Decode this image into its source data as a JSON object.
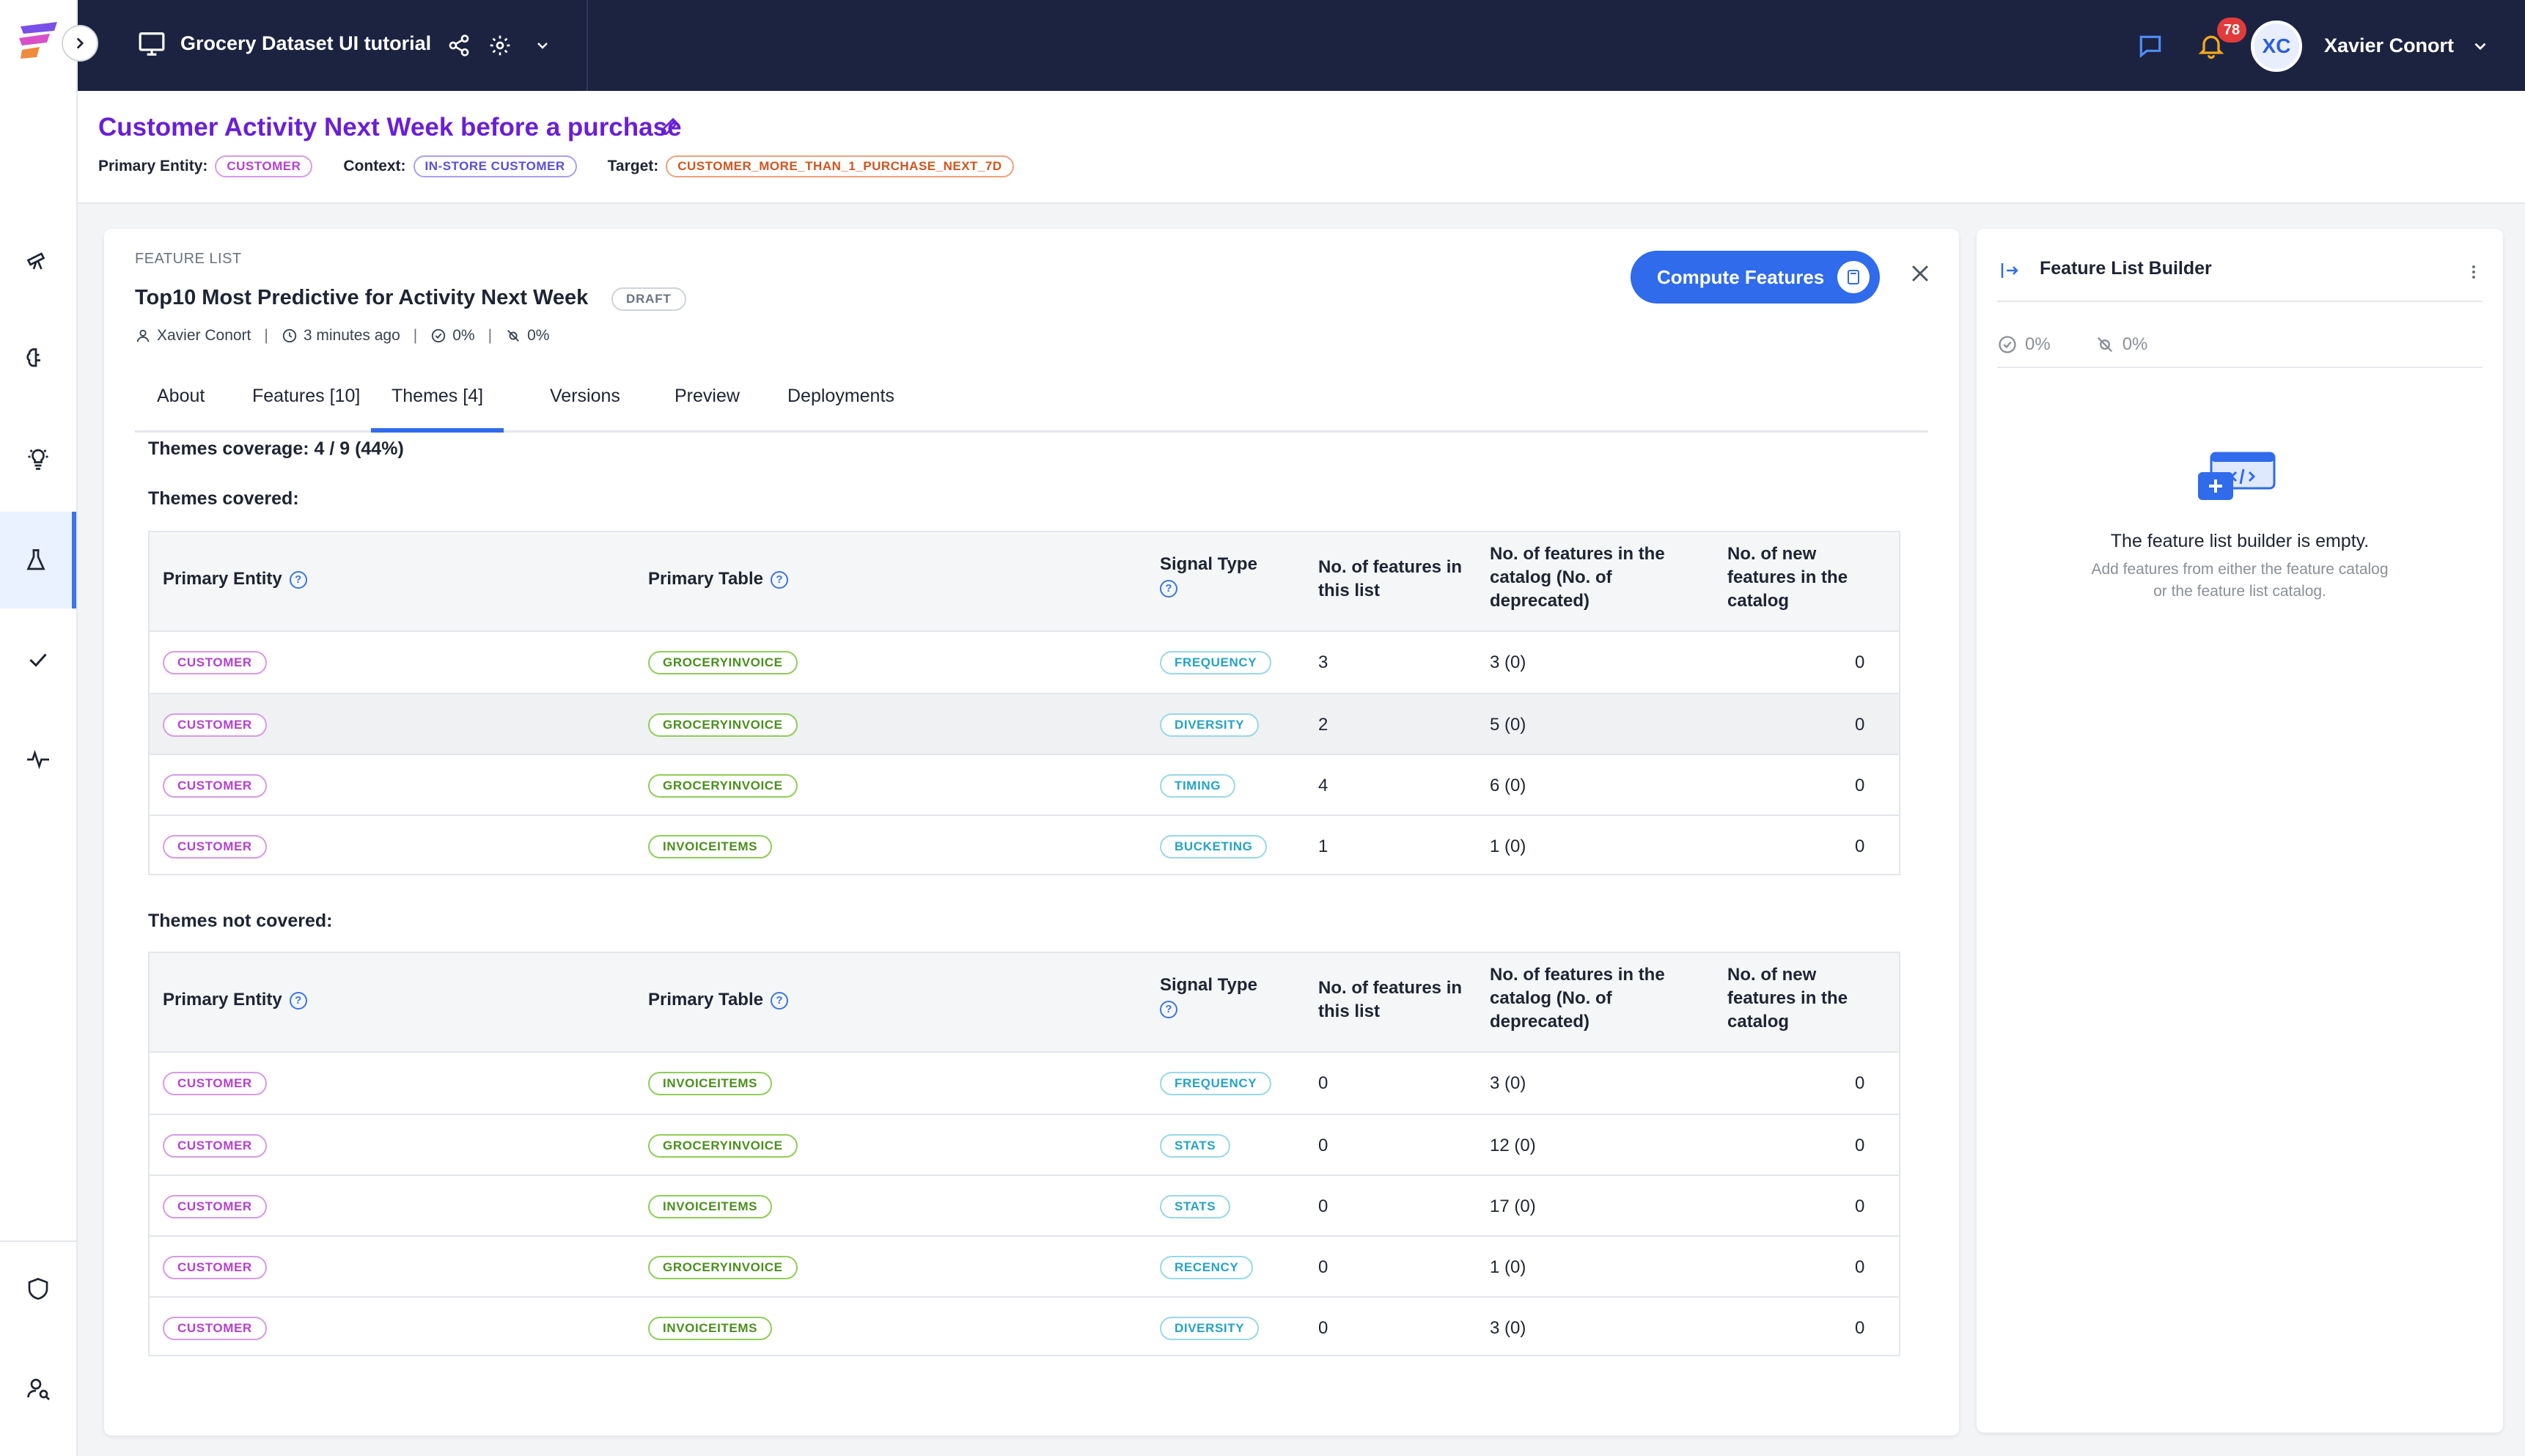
{
  "header": {
    "project_title": "Grocery Dataset UI tutorial",
    "notifications_count": "78",
    "user_initials": "XC",
    "user_name": "Xavier Conort"
  },
  "context_strip": {
    "title": "Customer Activity Next Week before a purchase",
    "primary_entity_label": "Primary Entity:",
    "primary_entity": "CUSTOMER",
    "context_label": "Context:",
    "context": "IN-STORE CUSTOMER",
    "target_label": "Target:",
    "target": "CUSTOMER_MORE_THAN_1_PURCHASE_NEXT_7D"
  },
  "feature_list": {
    "eyebrow": "FEATURE LIST",
    "name": "Top10 Most Predictive for Activity Next Week",
    "status": "DRAFT",
    "owner": "Xavier Conort",
    "updated": "3 minutes ago",
    "readiness_pct": "0%",
    "deprecated_pct": "0%",
    "compute_label": "Compute Features",
    "tabs": [
      "About",
      "Features [10]",
      "Themes [4]",
      "Versions",
      "Preview",
      "Deployments"
    ],
    "active_tab": "Themes [4]",
    "coverage": "Themes coverage: 4 / 9 (44%)",
    "covered_label": "Themes covered:",
    "not_covered_label": "Themes not covered:"
  },
  "table_headers": {
    "primary_entity": "Primary Entity",
    "primary_table": "Primary Table",
    "signal_type": "Signal Type",
    "features_in_list": "No. of features in this list",
    "features_in_catalog": "No. of features in the catalog (No. of deprecated)",
    "new_features": "No. of new features in the catalog"
  },
  "themes_covered": [
    {
      "entity": "CUSTOMER",
      "table": "GROCERYINVOICE",
      "signal": "FREQUENCY",
      "in_list": "3",
      "in_catalog": "3 (0)",
      "new": "0"
    },
    {
      "entity": "CUSTOMER",
      "table": "GROCERYINVOICE",
      "signal": "DIVERSITY",
      "in_list": "2",
      "in_catalog": "5 (0)",
      "new": "0"
    },
    {
      "entity": "CUSTOMER",
      "table": "GROCERYINVOICE",
      "signal": "TIMING",
      "in_list": "4",
      "in_catalog": "6 (0)",
      "new": "0"
    },
    {
      "entity": "CUSTOMER",
      "table": "INVOICEITEMS",
      "signal": "BUCKETING",
      "in_list": "1",
      "in_catalog": "1 (0)",
      "new": "0"
    }
  ],
  "themes_not_covered": [
    {
      "entity": "CUSTOMER",
      "table": "INVOICEITEMS",
      "signal": "FREQUENCY",
      "in_list": "0",
      "in_catalog": "3 (0)",
      "new": "0"
    },
    {
      "entity": "CUSTOMER",
      "table": "GROCERYINVOICE",
      "signal": "STATS",
      "in_list": "0",
      "in_catalog": "12 (0)",
      "new": "0"
    },
    {
      "entity": "CUSTOMER",
      "table": "INVOICEITEMS",
      "signal": "STATS",
      "in_list": "0",
      "in_catalog": "17 (0)",
      "new": "0"
    },
    {
      "entity": "CUSTOMER",
      "table": "GROCERYINVOICE",
      "signal": "RECENCY",
      "in_list": "0",
      "in_catalog": "1 (0)",
      "new": "0"
    },
    {
      "entity": "CUSTOMER",
      "table": "INVOICEITEMS",
      "signal": "DIVERSITY",
      "in_list": "0",
      "in_catalog": "3 (0)",
      "new": "0"
    }
  ],
  "builder": {
    "title": "Feature List Builder",
    "readiness_pct": "0%",
    "deprecated_pct": "0%",
    "empty_title": "The feature list builder is empty.",
    "empty_sub_1": "Add features from either the feature catalog",
    "empty_sub_2": "or the feature list catalog."
  },
  "colors": {
    "nav_bg": "#1c2340",
    "accent_blue": "#2f6bea",
    "title_purple": "#6a1fd6",
    "entity_tag": "#b53fd2",
    "table_tag": "#4a8f1c",
    "signal_tag": "#25a2c7",
    "notification_badge": "#e23b3b"
  },
  "icons": {
    "rail": [
      "telescope-icon",
      "brain-icon",
      "lightbulb-icon",
      "flask-icon",
      "check-icon",
      "pulse-icon",
      "shield-icon",
      "user-search-icon"
    ]
  }
}
